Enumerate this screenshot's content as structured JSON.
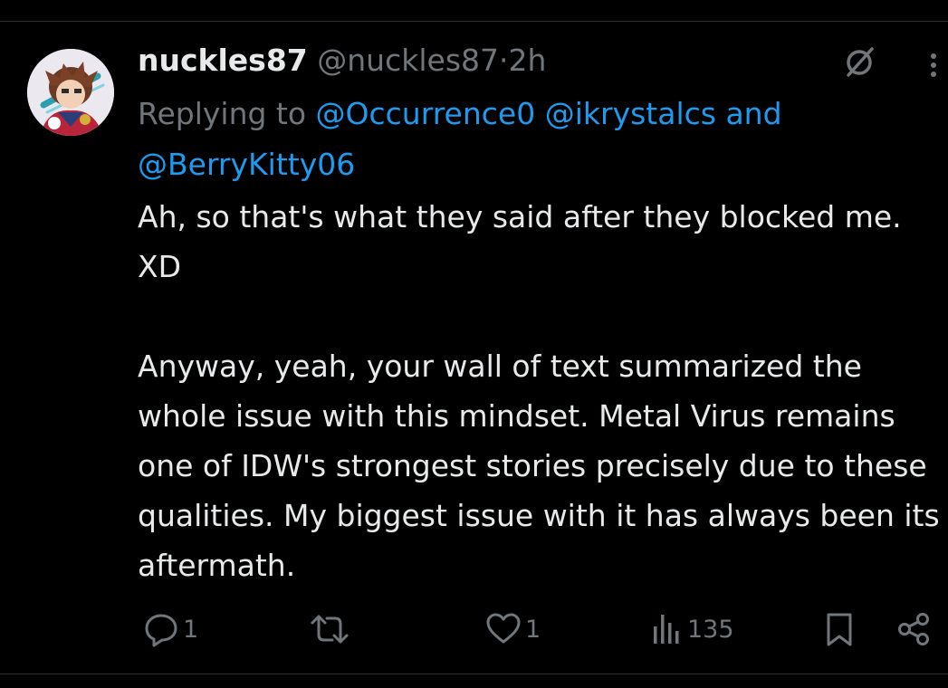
{
  "tweet": {
    "display_name": "nuckles87",
    "handle": "@nuckles87",
    "separator": "·",
    "time": "2h",
    "reply_prefix": "Replying to",
    "reply_mentions": [
      "@Occurrence0",
      "@ikrystalcs",
      "@BerryKitty06"
    ],
    "reply_and": "and",
    "text_paragraphs": [
      "Ah, so that's what they said after they blocked me. XD",
      "Anyway, yeah, your wall of text summarized the whole issue with this mindset. Metal Virus remains one of IDW's strongest stories precisely due to these qualities. My biggest issue with it has always been its aftermath."
    ]
  },
  "actions": {
    "replies": "1",
    "reposts": "",
    "likes": "1",
    "views": "135"
  },
  "icons": {
    "avatar": "avatar-image",
    "grok": "grok-icon",
    "more": "more-icon",
    "reply": "reply-icon",
    "repost": "repost-icon",
    "like": "heart-icon",
    "views": "views-icon",
    "bookmark": "bookmark-icon",
    "share": "share-icon"
  },
  "colors": {
    "background": "#000000",
    "text": "#e7e9ea",
    "secondary": "#71767b",
    "link": "#1d9bf0",
    "divider": "#2f3336"
  }
}
